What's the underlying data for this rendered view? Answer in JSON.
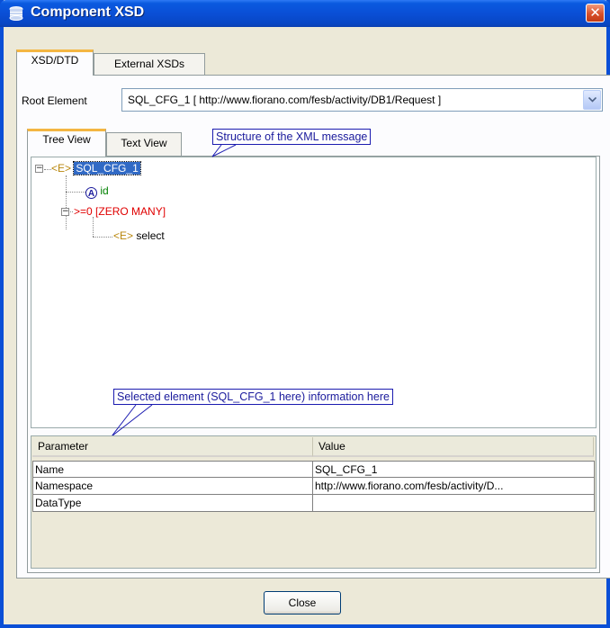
{
  "window": {
    "title": "Component XSD",
    "close_symbol": "✕"
  },
  "outer_tabs": [
    "XSD/DTD",
    "External XSDs"
  ],
  "root_element": {
    "label": "Root Element",
    "value": "SQL_CFG_1 [ http://www.fiorano.com/fesb/activity/DB1/Request ]"
  },
  "view_tabs": [
    "Tree View",
    "Text View"
  ],
  "callouts": {
    "structure": "Structure of the XML message",
    "selected_info": "Selected element (SQL_CFG_1 here) information here"
  },
  "tree": {
    "root": {
      "badge": "<E>",
      "name": "SQL_CFG_1",
      "expander": "−"
    },
    "attr": {
      "badge": "A",
      "name": "id"
    },
    "group": {
      "label": ">=0 [ZERO MANY]",
      "expander": "−"
    },
    "child": {
      "badge": "<E>",
      "name": "select"
    }
  },
  "properties": {
    "columns": [
      "Parameter",
      "Value"
    ],
    "rows": [
      {
        "param": "Name",
        "value": "SQL_CFG_1"
      },
      {
        "param": "Namespace",
        "value": "http://www.fiorano.com/fesb/activity/D..."
      },
      {
        "param": "DataType",
        "value": ""
      }
    ]
  },
  "buttons": {
    "close": "Close"
  },
  "colors": {
    "titlebar": "#0a4fd6",
    "selection": "#316ac5",
    "attr": "#008000",
    "group": "#e00000",
    "callout": "#1a1a9c"
  }
}
